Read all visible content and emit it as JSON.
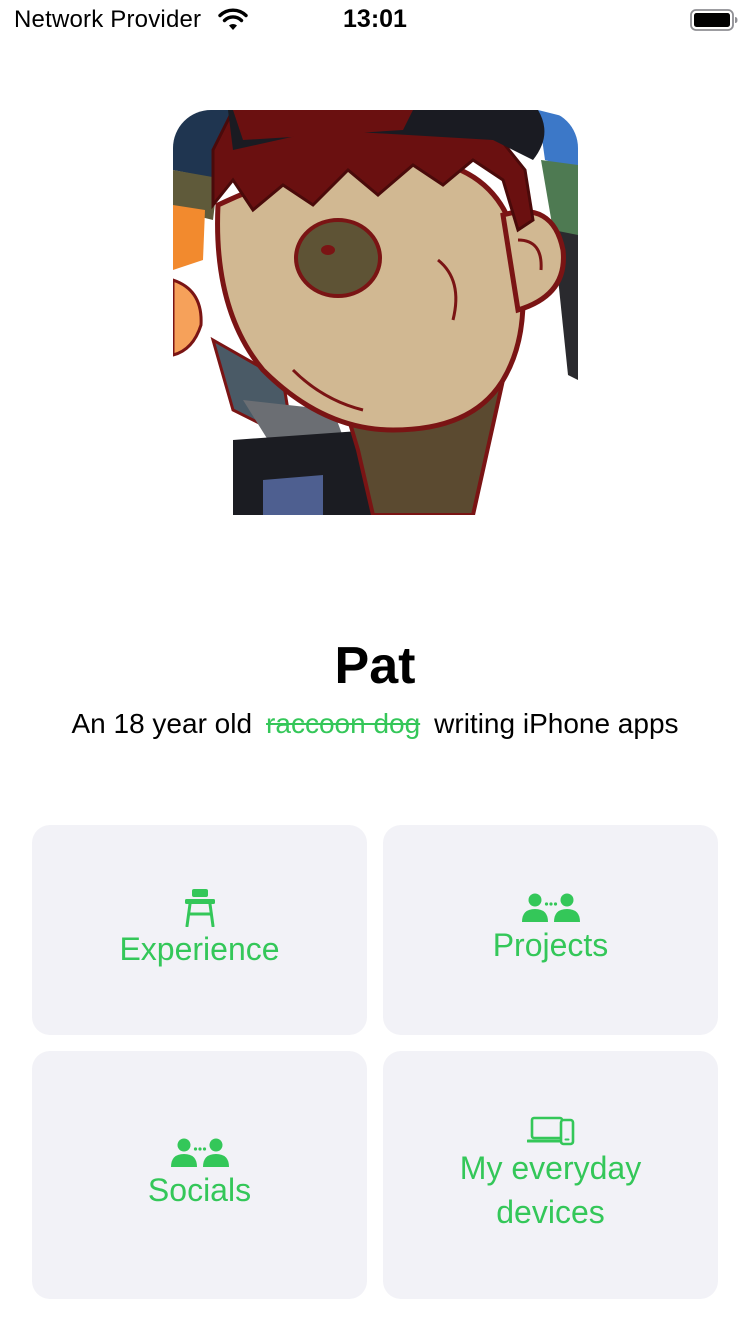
{
  "status_bar": {
    "carrier": "Network Provider",
    "time": "13:01"
  },
  "profile": {
    "name": "Pat",
    "tagline_prefix": "An 18 year old",
    "tagline_struck": "raccoon dog",
    "tagline_suffix": "writing iPhone apps"
  },
  "cards": {
    "experience": {
      "label": "Experience",
      "icon": "school-desk-icon"
    },
    "projects": {
      "label": "Projects",
      "icon": "people-icon"
    },
    "socials": {
      "label": "Socials",
      "icon": "people-icon"
    },
    "devices": {
      "label": "My everyday devices",
      "icon": "laptop-phone-icon"
    }
  },
  "colors": {
    "accent": "#34c759",
    "card_background": "#f2f2f7"
  }
}
